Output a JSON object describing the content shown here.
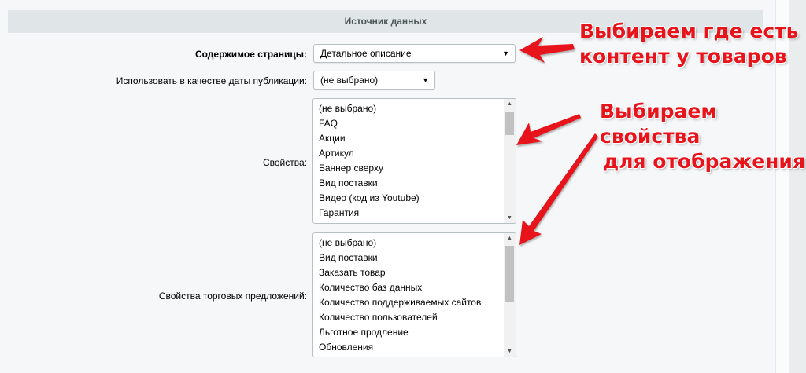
{
  "section_title": "Источник данных",
  "fields": {
    "page_content": {
      "label": "Содержимое страницы:",
      "value": "Детальное описание"
    },
    "pub_date": {
      "label": "Использовать в качестве даты публикации:",
      "value": "(не выбрано)"
    },
    "properties": {
      "label": "Свойства:",
      "items": [
        "(не выбрано)",
        "FAQ",
        "Акции",
        "Артикул",
        "Баннер сверху",
        "Вид поставки",
        "Видео (код из Youtube)",
        "Гарантия"
      ]
    },
    "offer_properties": {
      "label": "Свойства торговых предложений:",
      "items": [
        "(не выбрано)",
        "Вид поставки",
        "Заказать товар",
        "Количество баз данных",
        "Количество поддерживаемых сайтов",
        "Количество пользователей",
        "Льготное продление",
        "Обновления"
      ]
    }
  },
  "annotations": {
    "content": [
      "Выбираем где есть",
      "контент у товаров"
    ],
    "properties": [
      "Выбираем свойства",
      "для отображения"
    ]
  },
  "colors": {
    "annotation": "#e8141c",
    "header": "#e0e6e8"
  }
}
